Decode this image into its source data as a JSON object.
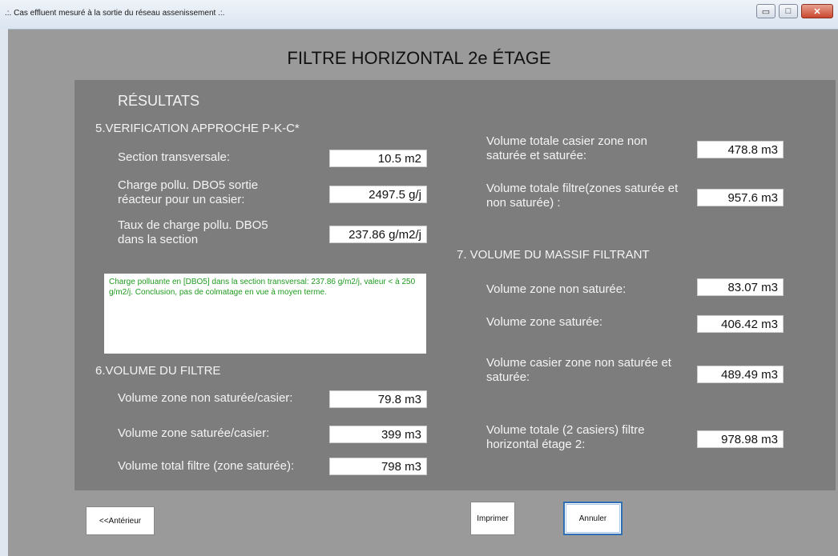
{
  "window": {
    "title": ".:. Cas effluent mesuré à la sortie du réseau assenissement .:.",
    "controls": {
      "minimize": "▭",
      "maximize": "□",
      "close": "✕"
    }
  },
  "page": {
    "heading": "FILTRE HORIZONTAL 2e ÉTAGE"
  },
  "results": {
    "title": "RÉSULTATS",
    "section5": {
      "title": "5.VERIFICATION APPROCHE P-K-C*",
      "rows": [
        {
          "label": "Section transversale:",
          "value": "10.5 m2"
        },
        {
          "label": "Charge pollu. DBO5 sortie réacteur  pour un casier:",
          "value": "2497.5 g/j"
        },
        {
          "label": "Taux de charge pollu. DBO5 dans la section",
          "value": "237.86 g/m2/j"
        }
      ],
      "note": "Charge polluante en [DBO5] dans la section transversal: 237.86 g/m2/j, valeur < à 250 g/m2/j. Conclusion, pas de colmatage en vue à moyen terme."
    },
    "section6": {
      "title": "6.VOLUME DU FILTRE",
      "rows": [
        {
          "label": "Volume zone non saturée/casier:",
          "value": "79.8 m3"
        },
        {
          "label": "Volume zone saturée/casier:",
          "value": "399 m3"
        },
        {
          "label": "Volume total filtre (zone saturée):",
          "value": "798 m3"
        }
      ]
    },
    "right_top": {
      "rows": [
        {
          "label": "Volume totale casier zone non saturée et saturée:",
          "value": "478.8 m3"
        },
        {
          "label": "Volume totale filtre(zones saturée et non saturée) :",
          "value": "957.6 m3"
        }
      ]
    },
    "section7": {
      "title": "7. VOLUME DU MASSIF FILTRANT",
      "rows": [
        {
          "label": "Volume zone non saturée:",
          "value": "83.07 m3"
        },
        {
          "label": "Volume zone saturée:",
          "value": "406.42 m3"
        },
        {
          "label": "Volume casier zone non saturée et saturée:",
          "value": "489.49 m3"
        },
        {
          "label": "Volume totale (2 casiers)  filtre horizontal étage 2:",
          "value": "978.98 m3"
        }
      ]
    }
  },
  "buttons": {
    "previous": "<<Antérieur",
    "print": "Imprimer",
    "cancel": "Annuler"
  }
}
